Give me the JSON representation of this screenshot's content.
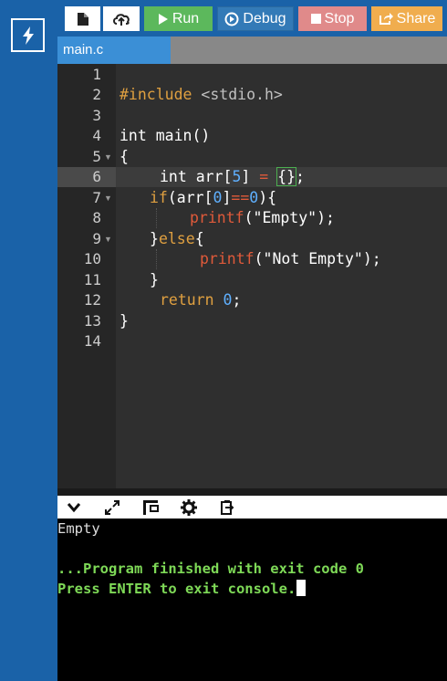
{
  "toolbar": {
    "new_icon": "new-file-icon",
    "upload_icon": "upload-icon",
    "run_label": "Run",
    "debug_label": "Debug",
    "stop_label": "Stop",
    "share_label": "Share"
  },
  "tabs": [
    {
      "label": "main.c",
      "active": true
    }
  ],
  "editor": {
    "line_numbers": [
      "1",
      "2",
      "3",
      "4",
      "5",
      "6",
      "7",
      "8",
      "9",
      "10",
      "11",
      "12",
      "13",
      "14"
    ],
    "active_line": 6
  },
  "code": {
    "l2_include": "#include",
    "l2_header": "<stdio.h>",
    "l4_type": "int",
    "l4_rest": " main()",
    "l5": "{",
    "l6_a": "int arr[",
    "l6_num": "5",
    "l6_b": "] ",
    "l6_eq": "=",
    "l6_c": " ",
    "l6_brace": "{}",
    "l6_d": ";",
    "l7_kw": "if",
    "l7_a": "(arr[",
    "l7_num0": "0",
    "l7_b": "]",
    "l7_op": "==",
    "l7_num1": "0",
    "l7_c": "){",
    "l8_fn": "printf",
    "l8_a": "(\"Empty\");",
    "l9_a": "}",
    "l9_kw": "else",
    "l9_b": "{",
    "l10_fn": "printf",
    "l10_a": "(\"Not Empty\");",
    "l11": "}",
    "l12_kw": "return",
    "l12_num": "0",
    "l12_a": ";",
    "l13": "}"
  },
  "console": {
    "output": "Empty",
    "finished_msg": "...Program finished with exit code 0",
    "press_msg": "Press ENTER to exit console."
  },
  "colors": {
    "sidebar": "#1a62a8",
    "run": "#5cb85c",
    "debug": "#337ab7",
    "stop": "#e08a8a",
    "share": "#f0ad4e",
    "console_msg": "#7ed957"
  }
}
